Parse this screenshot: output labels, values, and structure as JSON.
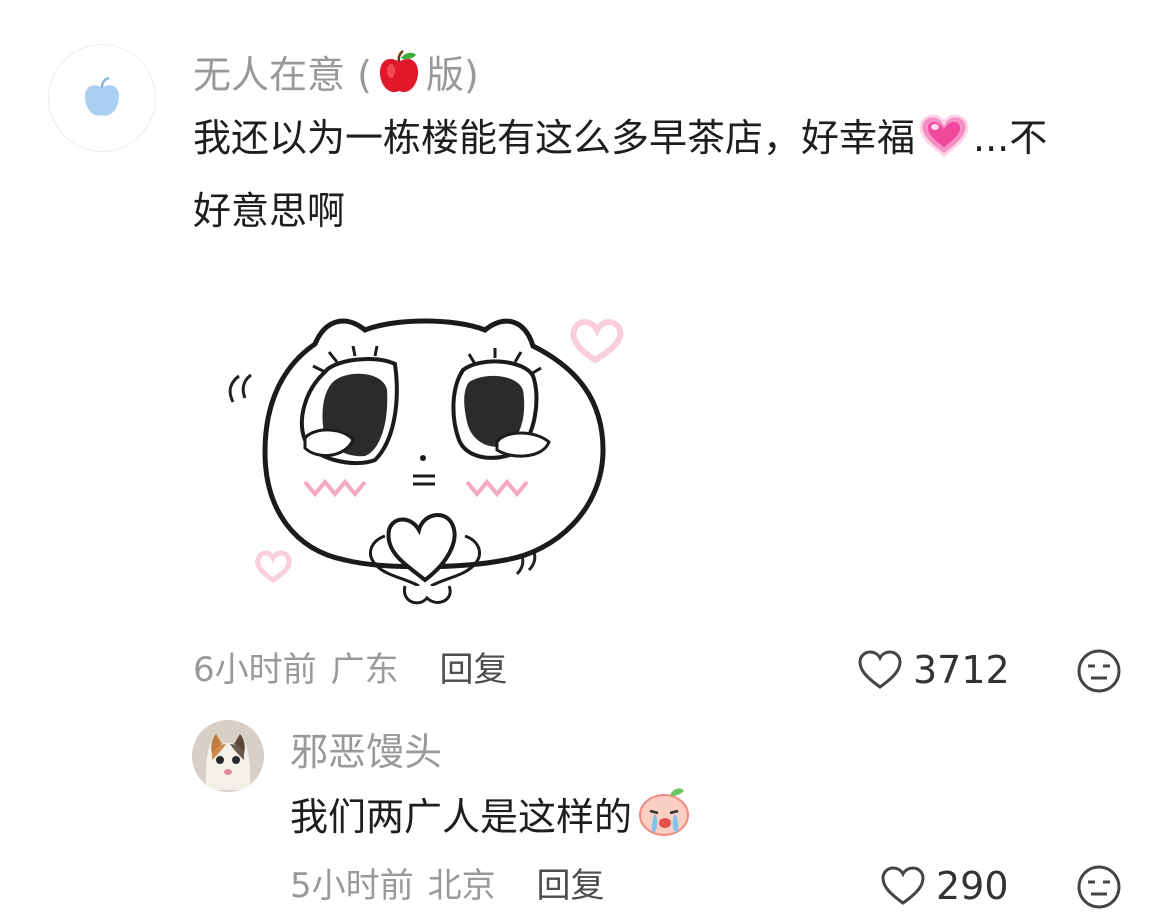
{
  "comment": {
    "username": "无人在意",
    "username_open": "(",
    "username_badge_icon": "apple-emoji",
    "username_suffix": "版)",
    "text_line1": "我还以为一栋楼能有这么多早茶店，好幸福",
    "text_heart_icon": "pink-heart-emoji",
    "text_line1_tail": "...不",
    "text_line2": "好意思啊",
    "sticker_icon": "cat-heart-hands-sticker",
    "time": "6小时前",
    "location": "广东",
    "reply_label": "回复",
    "likes": "3712"
  },
  "reply": {
    "username": "邪恶馒头",
    "text": "我们两广人是这样的",
    "text_emoji_icon": "crying-face-emoji",
    "time": "5小时前",
    "location": "北京",
    "reply_label": "回复",
    "likes": "290"
  },
  "colors": {
    "meta": "#9a9a9a",
    "text": "#1e1e1e",
    "pink": "#f5a9c4"
  }
}
